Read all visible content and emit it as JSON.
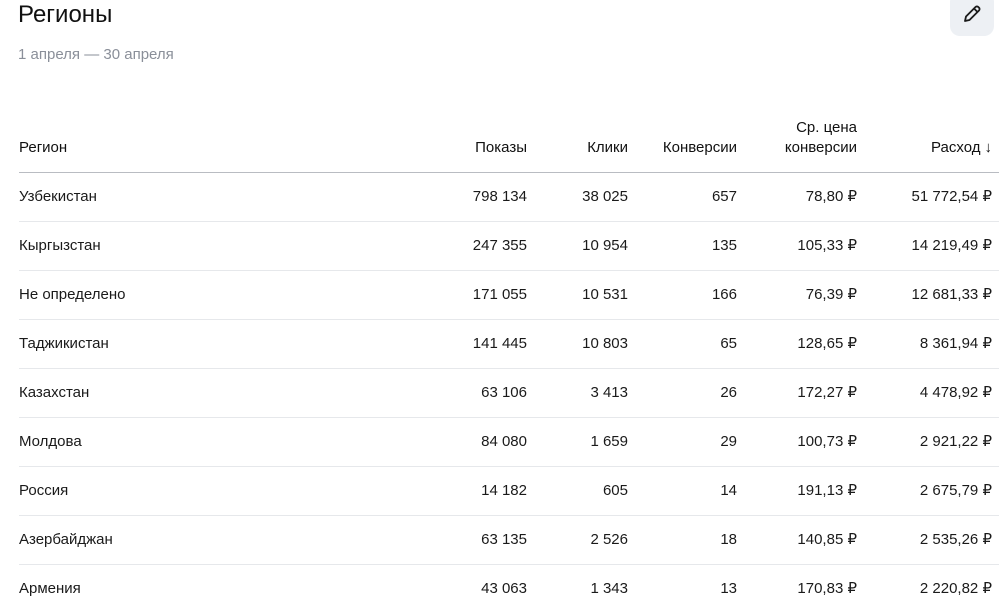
{
  "header": {
    "title": "Регионы",
    "period": "1 апреля — 30 апреля"
  },
  "table": {
    "columns": {
      "region": "Регион",
      "shows": "Показы",
      "clicks": "Клики",
      "conversions": "Конверсии",
      "avg_price_line1": "Ср. цена",
      "avg_price_line2": "конверсии",
      "spend": "Расход",
      "sort_indicator": "↓"
    },
    "rows": [
      {
        "region": "Узбекистан",
        "shows": "798 134",
        "clicks": "38 025",
        "conversions": "657",
        "avg_price": "78,80 ₽",
        "spend": "51 772,54 ₽"
      },
      {
        "region": "Кыргызстан",
        "shows": "247 355",
        "clicks": "10 954",
        "conversions": "135",
        "avg_price": "105,33 ₽",
        "spend": "14 219,49 ₽"
      },
      {
        "region": "Не определено",
        "shows": "171 055",
        "clicks": "10 531",
        "conversions": "166",
        "avg_price": "76,39 ₽",
        "spend": "12 681,33 ₽"
      },
      {
        "region": "Таджикистан",
        "shows": "141 445",
        "clicks": "10 803",
        "conversions": "65",
        "avg_price": "128,65 ₽",
        "spend": "8 361,94 ₽"
      },
      {
        "region": "Казахстан",
        "shows": "63 106",
        "clicks": "3 413",
        "conversions": "26",
        "avg_price": "172,27 ₽",
        "spend": "4 478,92 ₽"
      },
      {
        "region": "Молдова",
        "shows": "84 080",
        "clicks": "1 659",
        "conversions": "29",
        "avg_price": "100,73 ₽",
        "spend": "2 921,22 ₽"
      },
      {
        "region": "Россия",
        "shows": "14 182",
        "clicks": "605",
        "conversions": "14",
        "avg_price": "191,13 ₽",
        "spend": "2 675,79 ₽"
      },
      {
        "region": "Азербайджан",
        "shows": "63 135",
        "clicks": "2 526",
        "conversions": "18",
        "avg_price": "140,85 ₽",
        "spend": "2 535,26 ₽"
      },
      {
        "region": "Армения",
        "shows": "43 063",
        "clicks": "1 343",
        "conversions": "13",
        "avg_price": "170,83 ₽",
        "spend": "2 220,82 ₽"
      }
    ]
  }
}
